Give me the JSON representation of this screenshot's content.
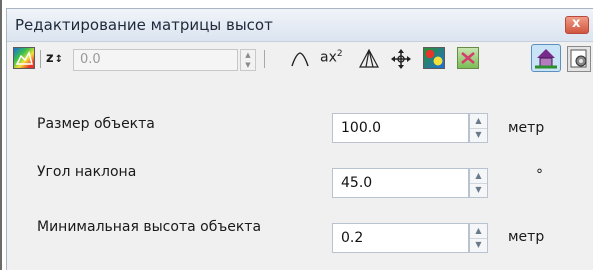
{
  "window": {
    "title": "Редактирование матрицы высот",
    "close_label": "x"
  },
  "toolbar": {
    "z_label": "z",
    "z_suffix": "↕",
    "z_value": "0.0",
    "icons": [
      "heightmap-icon",
      "peak-icon",
      "quadratic-ax2-icon",
      "pyramid-icon",
      "move-icon",
      "terrain-color-icon",
      "flatten-icon",
      "house-icon",
      "settings-icon"
    ],
    "ax2_text": "ax",
    "ax2_sup": "2"
  },
  "fields": [
    {
      "label": "Размер объекта",
      "value": "100.0",
      "unit": "метр"
    },
    {
      "label": "Угол наклона",
      "value": "45.0",
      "unit": "°"
    },
    {
      "label": "Минимальная высота объекта",
      "value": "0.2",
      "unit": "метр"
    }
  ],
  "colors": {
    "title_gradient_top": "#f1f4f9",
    "title_gradient_bottom": "#dbe4f0",
    "close_button": "#d2563f",
    "pressed_button": "#c9e3f7"
  }
}
